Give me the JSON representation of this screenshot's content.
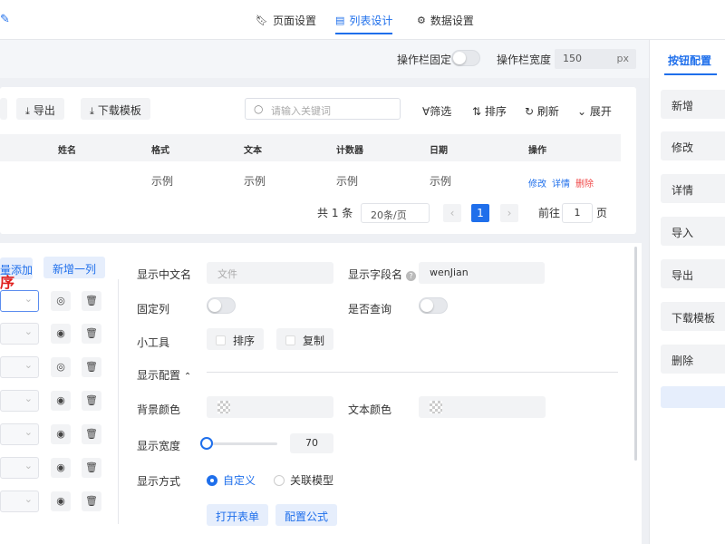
{
  "tabs": [
    {
      "label": "页面设置",
      "icon": "bookmark-icon"
    },
    {
      "label": "列表设计",
      "icon": "document-icon",
      "active": true
    },
    {
      "label": "数据设置",
      "icon": "gear-icon"
    }
  ],
  "subbar": {
    "fixed_label": "操作栏固定",
    "width_label": "操作栏宽度",
    "width_value": "150",
    "width_unit": "px"
  },
  "right_panel": {
    "title": "按钮配置",
    "items": [
      "新增",
      "修改",
      "详情",
      "导入",
      "导出",
      "下载模板",
      "删除"
    ]
  },
  "preview": {
    "toolbar": {
      "export": "导出",
      "download_template": "下载模板"
    },
    "search_placeholder": "请输入关键词",
    "tools": {
      "filter": "筛选",
      "sort": "排序",
      "refresh": "刷新",
      "expand": "展开"
    },
    "columns": [
      "姓名",
      "格式",
      "文本",
      "计数器",
      "日期",
      "操作"
    ],
    "row": {
      "cells": [
        "示例",
        "示例",
        "示例",
        "示例"
      ],
      "edit": "修改",
      "detail": "详情",
      "delete": "删除"
    },
    "pagination": {
      "total": "共 1 条",
      "page_size": "20条/页",
      "current": "1",
      "goto": "前往",
      "goto_value": "1",
      "page_unit": "页"
    }
  },
  "editor": {
    "batch_add": "量添加",
    "add_column": "新增一列",
    "red_mark": "序",
    "fields": {
      "display_name_label": "显示中文名",
      "display_name_value": "文件",
      "field_name_label": "显示字段名",
      "field_name_value": "wenJian",
      "fixed_col_label": "固定列",
      "query_label": "是否查询",
      "tools_label": "小工具",
      "tool_sort": "排序",
      "tool_copy": "复制",
      "display_config": "显示配置",
      "bg_color_label": "背景颜色",
      "text_color_label": "文本颜色",
      "width_label": "显示宽度",
      "width_value": "70",
      "width_fraction": 0.0,
      "mode_label": "显示方式",
      "mode_custom": "自定义",
      "mode_linked": "关联模型",
      "open_form": "打开表单",
      "config_formula": "配置公式"
    }
  },
  "colors": {
    "accent": "#1f6feb",
    "danger": "#f04848",
    "annotation_red": "#e0201e"
  }
}
